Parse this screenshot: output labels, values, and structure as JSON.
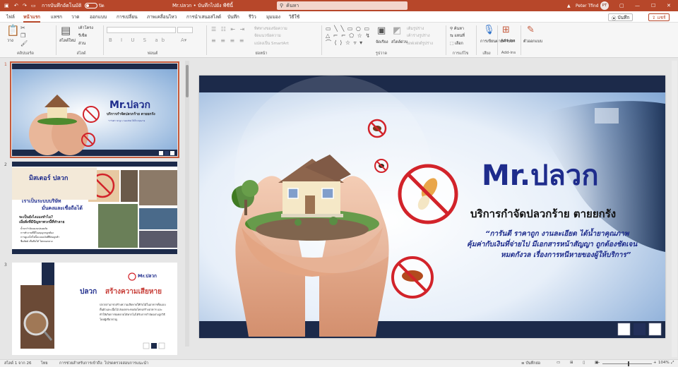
{
  "titlebar": {
    "autosave_label": "การบันทึกอัตโนมัติ",
    "autosave_state": "ปิด",
    "doc_title": "Mr.ปลวก • บันทึกไปยัง พีซีนี้",
    "search_placeholder": "ค้นหา",
    "user_name": "Peter Tfind",
    "user_initials": "PT",
    "accent_color": "#b7472a"
  },
  "menu": {
    "tabs": [
      "ไฟล์",
      "หน้าแรก",
      "แทรก",
      "วาด",
      "ออกแบบ",
      "การเปลี่ยน",
      "ภาพเคลื่อนไหว",
      "การนำเสนอสไลด์",
      "บันทึก",
      "รีวิว",
      "มุมมอง",
      "วิธีใช้"
    ],
    "active_tab": "หน้าแรก",
    "record_button": "บันทึก",
    "share_button": "แชร์"
  },
  "ribbon": {
    "groups": [
      "คลิปบอร์ด",
      "สไลด์",
      "ฟอนต์",
      "ย่อหน้า",
      "รูปวาด",
      "การแก้ไข",
      "เสียง",
      "Add-ins"
    ],
    "paste": "วาง",
    "new_slide": "สไลด์ใหม่",
    "layout": "เค้าโครง",
    "reset": "รีเซ็ต",
    "section": "ส่วน",
    "text_direction": "ทิศทางของข้อความ",
    "align_text": "จัดแนวข้อความ",
    "smartart": "แปลงเป็น SmartArt",
    "arrange": "จัดเรียง",
    "quick_styles": "สไตล์ด่วน",
    "shape_fill": "เติมรูปร่าง",
    "shape_outline": "เค้าร่างรูปร่าง",
    "shape_effects": "เอฟเฟกต์รูปร่าง",
    "find": "ค้นหา",
    "replace": "แทนที่",
    "select": "เลือก",
    "dictate": "การเขียนตามคำบอก",
    "addins": "Add-ins",
    "designer": "ตัวออกแบบ"
  },
  "slides": {
    "current_slide_num": 1,
    "thumb2": {
      "brand": "มิสเตอร์ ปลวก",
      "headline1": "เราเป็นระบบบริษัท",
      "headline2": "มั่นคงและเชื่อถือได้",
      "question": "จะเป็นยังไงแมงทำไม?",
      "question2": "เมื่อสิ่งที่มีปัญหาพวกนี้ที่ทำลาย",
      "bullets": [
        "น้ำยากำจัดแมลงปลอดภัย",
        "การทำงานที่มีใบอนุญาตถูกต้อง",
        "การดูแลใส่ใจทั้งแบบฉบับที่ดีต่อลูกค้า",
        "ซื่อสัตย์ เชื่อถือได้ ไม่หลอกลวง"
      ]
    },
    "thumb3": {
      "logo": "Mr.ปลวก",
      "title_a": "ปลวก",
      "title_b": "สร้างความเสียหาย",
      "body": "ปลวกสามารถสร้างความเสียหายให้กับไม้ในอาคารทั้งแบบพื้นผิวและเนื้อไม้ ส่งผลกระทบต่อโครงสร้างอาคาร และทำให้เกิดการพังทลายได้หากไม่ได้รับการกำจัดอย่างถูกวิธีโดยผู้เชี่ยวชาญ"
    }
  },
  "main_slide": {
    "title": "Mr.ปลวก",
    "subtitle": "บริการกำจัดปลวกร้าย ตายยกรัง",
    "quote_line1": "“การันตี ราคาถูก งานละเอียด ได้น้ำยาคุณภาพ",
    "quote_line2": "คุ้มค่ากับเงินที่จ่ายไป มีเอกสารหน้าสัญญา ถูกต้องชัดเจน",
    "quote_line3": "หมดกังวล เรื่องการหนีหายของผู้ให้บริการ”",
    "title_color": "#1e2c8c",
    "band_color": "#1c2a4a",
    "ban_color": "#d2232a"
  },
  "status": {
    "slide_info": "สไลด์ 1 จาก 26",
    "language": "ไทย",
    "accessibility": "การช่วยสำหรับการเข้าถึง: โปรดตรวจสอบการแนะนำ",
    "notes": "บันทึกย่อ",
    "zoom": "104%"
  }
}
